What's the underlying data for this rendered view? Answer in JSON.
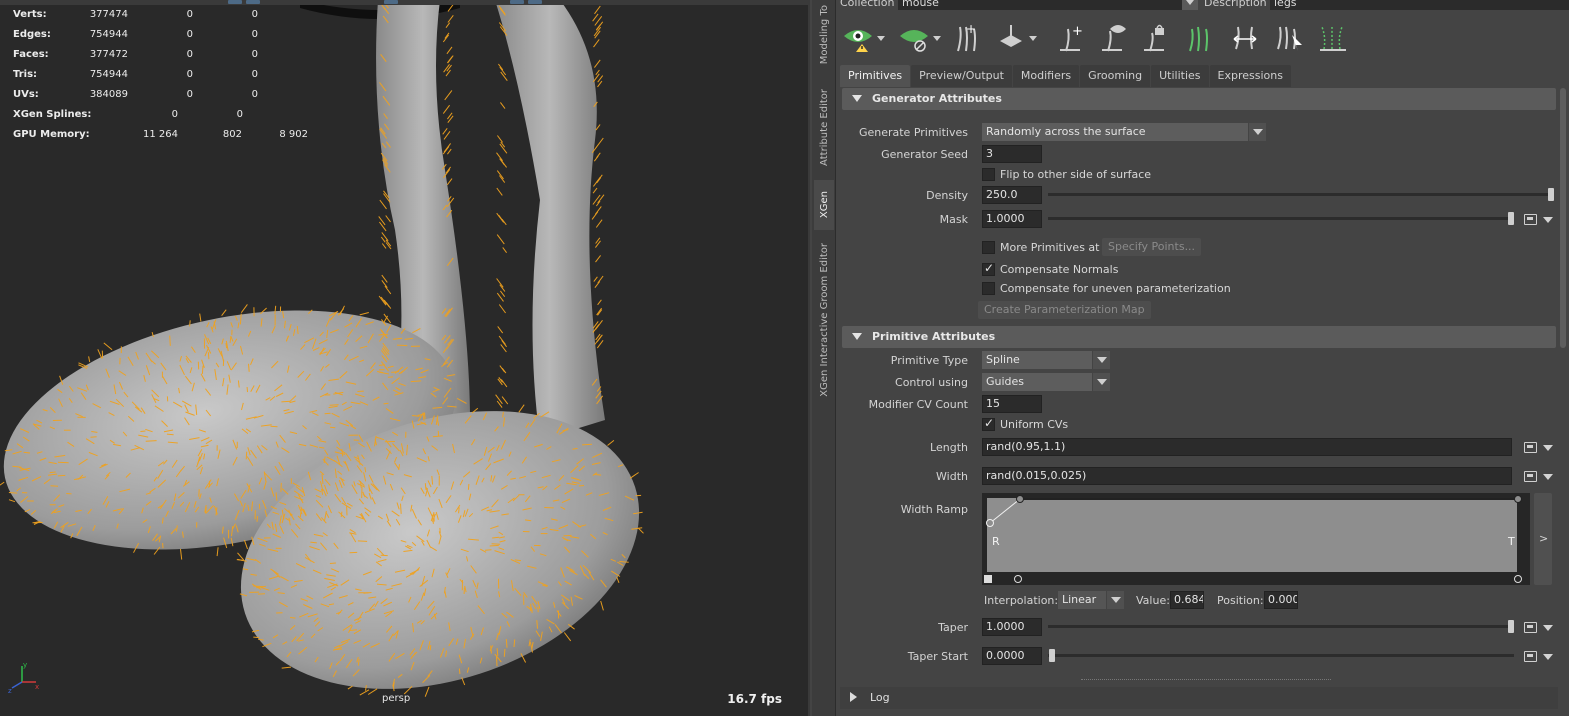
{
  "viewport": {
    "stats": [
      {
        "label": "Verts:",
        "values": [
          "377474",
          "0",
          "0"
        ]
      },
      {
        "label": "Edges:",
        "values": [
          "754944",
          "0",
          "0"
        ]
      },
      {
        "label": "Faces:",
        "values": [
          "377472",
          "0",
          "0"
        ]
      },
      {
        "label": "Tris:",
        "values": [
          "754944",
          "0",
          "0"
        ]
      },
      {
        "label": "UVs:",
        "values": [
          "384089",
          "0",
          "0"
        ]
      },
      {
        "label": "XGen Splines:",
        "values": [
          "0",
          "0"
        ]
      },
      {
        "label": "GPU Memory:",
        "values": [
          "11 264",
          "802",
          "8 902"
        ]
      }
    ],
    "camera": "persp",
    "fps": "16.7 fps",
    "axis": {
      "y": "y",
      "x": "x",
      "z": "z"
    }
  },
  "side_tabs": [
    "Modeling To",
    "Attribute Editor",
    "XGen",
    "XGen Interactive Groom Editor"
  ],
  "header": {
    "collection_label": "Collection",
    "collection_value": "mouse",
    "description_label": "Description",
    "description_value": "legs"
  },
  "toolbar_icons": [
    "preview-eye-warning-icon",
    "hide-eye-icon",
    "add-guide-icon",
    "move-guide-icon",
    "add-guide-plus-icon",
    "guide-visibility-icon",
    "lock-guide-icon",
    "rebuild-guides-icon",
    "flip-guides-icon",
    "select-guides-icon",
    "guides-to-curves-icon"
  ],
  "tabs": [
    "Primitives",
    "Preview/Output",
    "Modifiers",
    "Grooming",
    "Utilities",
    "Expressions"
  ],
  "generator": {
    "title": "Generator Attributes",
    "generate_label": "Generate Primitives",
    "generate_value": "Randomly across the surface",
    "seed_label": "Generator Seed",
    "seed_value": "3",
    "flip_label": "Flip to other side of surface",
    "density_label": "Density",
    "density_value": "250.0",
    "mask_label": "Mask",
    "mask_value": "1.0000",
    "more_label": "More Primitives at",
    "specify_label": "Specify Points...",
    "compensate_normals_label": "Compensate Normals",
    "compensate_uneven_label": "Compensate for uneven parameterization",
    "create_map_label": "Create Parameterization Map"
  },
  "primitive": {
    "title": "Primitive Attributes",
    "type_label": "Primitive Type",
    "type_value": "Spline",
    "control_label": "Control using",
    "control_value": "Guides",
    "cv_label": "Modifier CV Count",
    "cv_value": "15",
    "uniform_label": "Uniform CVs",
    "length_label": "Length",
    "length_value": "rand(0.95,1.1)",
    "width_label": "Width",
    "width_value": "rand(0.015,0.025)",
    "ramp_label": "Width Ramp",
    "ramp_left": "R",
    "ramp_right": "T",
    "ramp_expand": ">",
    "interp_label": "Interpolation:",
    "interp_value": "Linear",
    "value_label": "Value:",
    "value_value": "0.684",
    "position_label": "Position:",
    "position_value": "0.000",
    "taper_label": "Taper",
    "taper_value": "1.0000",
    "taper_start_label": "Taper Start",
    "taper_start_value": "0.0000"
  },
  "log": {
    "title": "Log"
  }
}
